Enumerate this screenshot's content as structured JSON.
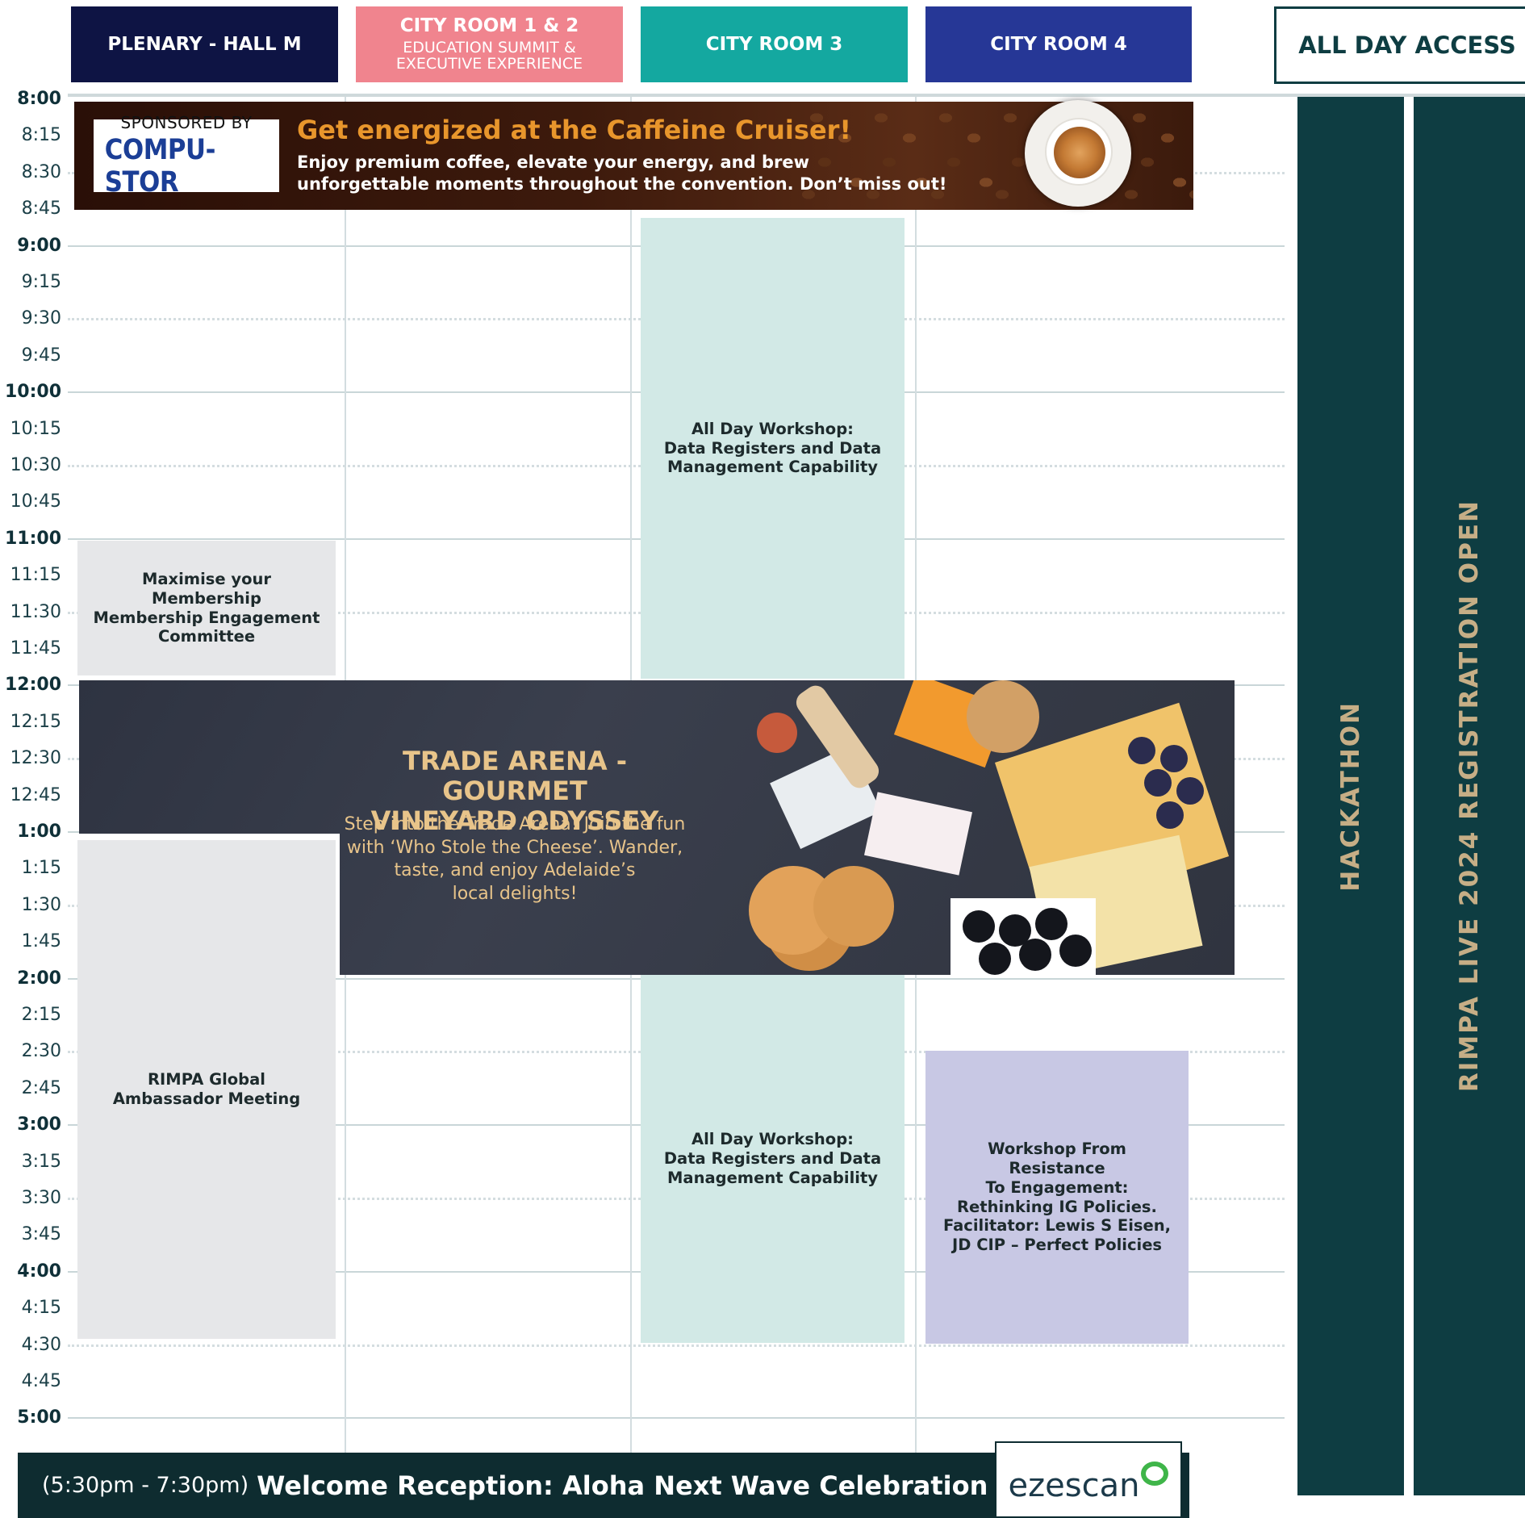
{
  "rooms": [
    {
      "title": "PLENARY - HALL M",
      "subtitle": "",
      "color": "#0e1444"
    },
    {
      "title": "CITY ROOM 1 & 2",
      "subtitle": "EDUCATION SUMMIT &\nEXECUTIVE EXPERIENCE",
      "color": "#f0848e"
    },
    {
      "title": "CITY ROOM 3",
      "subtitle": "",
      "color": "#14a8a0"
    },
    {
      "title": "CITY ROOM 4",
      "subtitle": "",
      "color": "#263796"
    }
  ],
  "all_day_access": {
    "label": "ALL DAY ACCESS",
    "columns": [
      "HACKATHON",
      "RIMPA LIVE 2024 REGISTRATION OPEN"
    ]
  },
  "times": [
    "8:00",
    "8:15",
    "8:30",
    "8:45",
    "9:00",
    "9:15",
    "9:30",
    "9:45",
    "10:00",
    "10:15",
    "10:30",
    "10:45",
    "11:00",
    "11:15",
    "11:30",
    "11:45",
    "12:00",
    "12:15",
    "12:30",
    "12:45",
    "1:00",
    "1:15",
    "1:30",
    "1:45",
    "2:00",
    "2:15",
    "2:30",
    "2:45",
    "3:00",
    "3:15",
    "3:30",
    "3:45",
    "4:00",
    "4:15",
    "4:30",
    "4:45",
    "5:00"
  ],
  "sponsor_banner": {
    "sponsored_by": "SPONSORED BY",
    "sponsor_name": "COMPU-STOR",
    "headline": "Get energized at the Caffeine Cruiser!",
    "body": "Enjoy premium coffee, elevate your energy, and brew\nunforgettable moments throughout the convention. Don’t miss out!"
  },
  "trade_arena": {
    "title": "TRADE ARENA - GOURMET\nVINEYARD ODYSSEY",
    "body": "Step into the Trade Arena! Join the fun\nwith ‘Who Stole the Cheese’. Wander,\ntaste, and enjoy Adelaide’s\nlocal delights!"
  },
  "sessions": {
    "workshop_am": "All Day Workshop:\nData Registers and Data\nManagement Capability",
    "membership": "Maximise your Membership\nMembership Engagement\nCommittee",
    "ambassador": "RIMPA Global\nAmbassador Meeting",
    "workshop_pm": "All Day Workshop:\nData Registers and Data\nManagement Capability",
    "resistance": "Workshop From Resistance\nTo Engagement:\nRethinking IG Policies.\nFacilitator: Lewis S Eisen,\nJD CIP – Perfect Policies"
  },
  "reception": {
    "time": "(5:30pm - 7:30pm)",
    "title": "Welcome Reception: Aloha Next Wave Celebration",
    "sponsor_logo": "ezescan"
  },
  "colors": {
    "dark_teal": "#0e3d42",
    "gold": "#c6ae86",
    "workshop_bg": "#d2e9e6",
    "grey_session": "#e6e7e9",
    "lavender": "#c8c8e4",
    "banner_brown": "#3a150b",
    "headline_orange": "#e8962c"
  }
}
